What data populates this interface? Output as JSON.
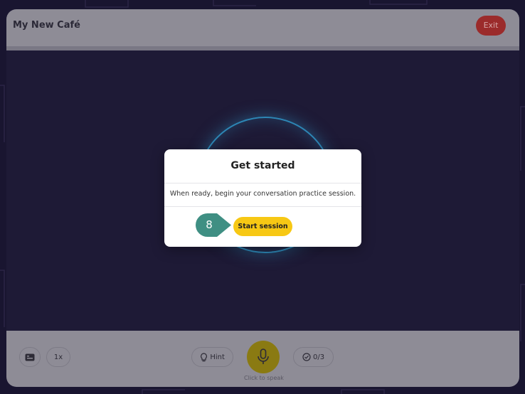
{
  "app": {
    "title": "My New Café",
    "exit_label": "Exit"
  },
  "modal": {
    "title": "Get started",
    "body": "When ready, begin your conversation practice session.",
    "start_label": "Start session"
  },
  "step_marker": {
    "number": "8"
  },
  "controls": {
    "speed_label": "1x",
    "hint_label": "Hint",
    "progress_label": "0/3",
    "mic_caption": "Click to speak"
  },
  "colors": {
    "accent_yellow": "#f7c814",
    "exit_red": "#9b2b2b",
    "marker_teal": "#3f8f83",
    "ring_blue": "#2d86b5",
    "background": "#191530"
  },
  "icons": [
    "captions-icon",
    "lightbulb-icon",
    "microphone-icon",
    "check-circle-icon"
  ]
}
